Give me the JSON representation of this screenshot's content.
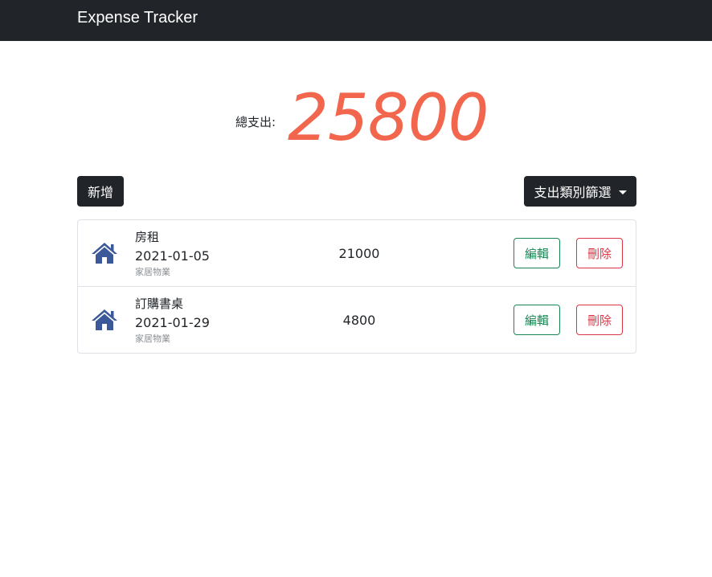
{
  "navbar": {
    "brand": "Expense Tracker"
  },
  "summary": {
    "label": "總支出:",
    "total": "25800"
  },
  "toolbar": {
    "add_label": "新增",
    "filter_label": "支出類別篩選"
  },
  "records": [
    {
      "name": "房租",
      "date": "2021-01-05",
      "category": "家居物業",
      "amount": "21000",
      "icon": "home-icon",
      "edit_label": "編輯",
      "delete_label": "刪除"
    },
    {
      "name": "訂購書桌",
      "date": "2021-01-29",
      "category": "家居物業",
      "amount": "4800",
      "icon": "home-icon",
      "edit_label": "編輯",
      "delete_label": "刪除"
    }
  ],
  "colors": {
    "navbar": "#212529",
    "total_amount": "#f2664e",
    "icon": "#3b5998",
    "edit": "#198754",
    "delete": "#dc3545"
  }
}
